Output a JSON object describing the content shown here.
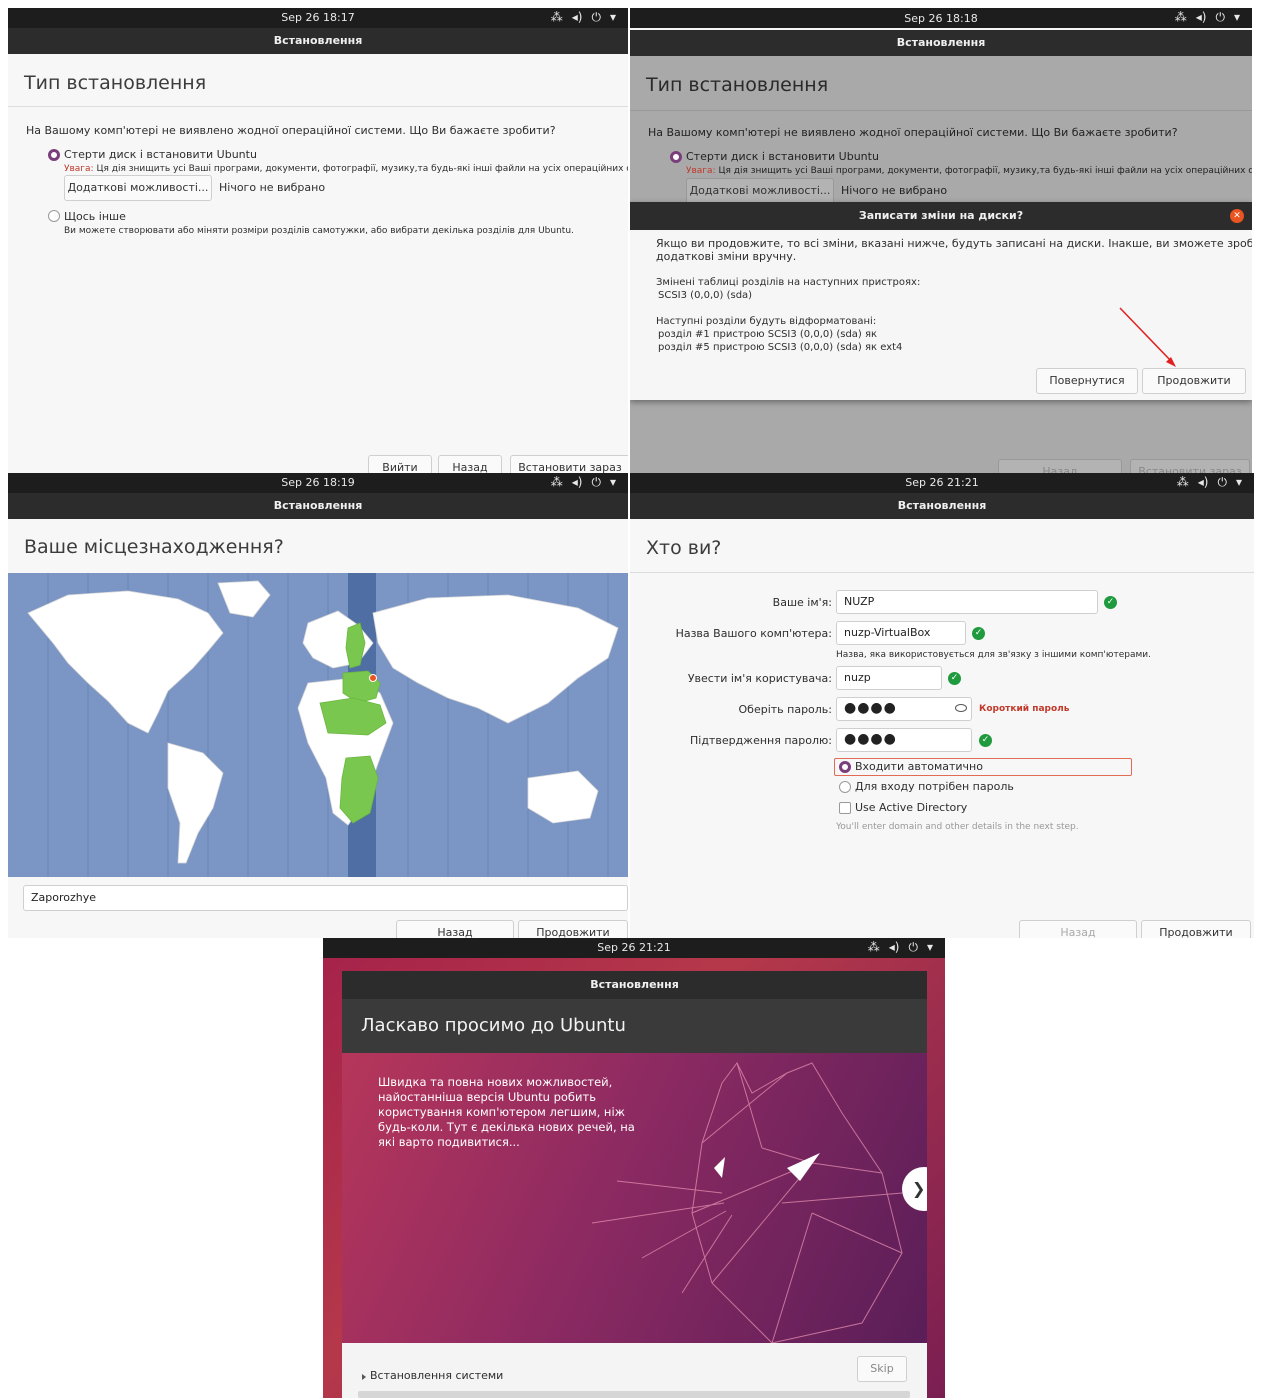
{
  "common": {
    "window_title": "Встановлення",
    "tray_network_icon": "⁂",
    "tray_volume_icon": "◂)",
    "tray_power_icon": "⏻",
    "tray_menu_icon": "▾"
  },
  "panel1": {
    "clock": "Sep 26  18:17",
    "heading": "Тип встановлення",
    "question": "На Вашому комп'ютері не виявлено жодної операційної системи. Що Ви бажаєте зробити?",
    "option_erase": "Стерти диск і встановити Ubuntu",
    "warning_label": "Увага:",
    "warning_text": "Ця дія знищить усі Ваші програми, документи, фотографії, музику,та будь-які інші файли на усіх операційних системах.",
    "advanced_button": "Додаткові можливості...",
    "nothing_selected": "Нічого не вибрано",
    "option_other": "Щось інше",
    "other_desc": "Ви можете створювати або міняти розміри розділів самотужки, або вибрати декілька розділів для Ubuntu.",
    "quit_button": "Вийти",
    "back_button": "Назад",
    "install_button": "Встановити зараз"
  },
  "panel2": {
    "clock": "Sep 26  18:18",
    "heading": "Тип встановлення",
    "question": "На Вашому комп'ютері не виявлено жодної операційної системи. Що Ви бажаєте зробити?",
    "option_erase": "Стерти диск і встановити Ubuntu",
    "warning_label": "Увага:",
    "warning_text": "Ця дія знищить усі Ваші програми, документи, фотографії, музику,та будь-які інші файли на усіх операційних системах.",
    "advanced_button": "Додаткові можливості...",
    "nothing_selected": "Нічого не вибрано",
    "back_button": "Назад",
    "install_button": "Встановити зараз",
    "dialog": {
      "title": "Записати зміни на диски?",
      "close_icon": "✕",
      "line1": "Якщо ви продовжите, то всі зміни, вказані нижче, будуть записані на диски. Інакше, ви зможете зробити",
      "line2": "додаткові зміни вручну.",
      "changed_tables": "Змінені таблиці розділів на наступних пристроях:",
      "device": "SCSI3 (0,0,0) (sda)",
      "formatted": "Наступні розділи будуть відформатовані:",
      "part1": "розділ #1 пристрою SCSI3 (0,0,0) (sda) як",
      "part5": "розділ #5 пристрою SCSI3 (0,0,0) (sda) як ext4",
      "go_back_button": "Повернутися",
      "continue_button": "Продовжити"
    }
  },
  "panel3": {
    "clock": "Sep 26  18:19",
    "heading": "Ваше місцезнаходження?",
    "location_value": "Zaporozhye",
    "back_button": "Назад",
    "continue_button": "Продовжити"
  },
  "panel4": {
    "clock": "Sep 26  21:21",
    "heading": "Хто ви?",
    "name_label": "Ваше ім'я:",
    "name_value": "NUZP",
    "computer_label": "Назва Вашого комп'ютера:",
    "computer_value": "nuzp-VirtualBox",
    "computer_hint": "Назва, яка використовується для зв'язку з іншими комп'ютерами.",
    "username_label": "Увести ім'я користувача:",
    "username_value": "nuzp",
    "password_label": "Оберіть пароль:",
    "password_value": "●●●●",
    "password_warning": "Короткий пароль",
    "confirm_label": "Підтвердження паролю:",
    "confirm_value": "●●●●",
    "auto_login": "Входити автоматично",
    "require_password": "Для входу потрібен пароль",
    "active_directory": "Use Active Directory",
    "ad_hint": "You'll enter domain and other details in the next step.",
    "back_button": "Назад",
    "continue_button": "Продовжити"
  },
  "panel5": {
    "clock": "Sep 26  21:21",
    "heading": "Ласкаво просимо до Ubuntu",
    "slide_text": [
      "Швидка та повна нових можливостей,",
      "найостанніша версія Ubuntu робить",
      "користування комп'ютером легшим, ніж",
      "будь-коли. Тут є декілька нових речей, на",
      "які варто подивитися..."
    ],
    "next_icon": "❯",
    "progress_label": "Встановлення системи",
    "skip_button": "Skip"
  }
}
